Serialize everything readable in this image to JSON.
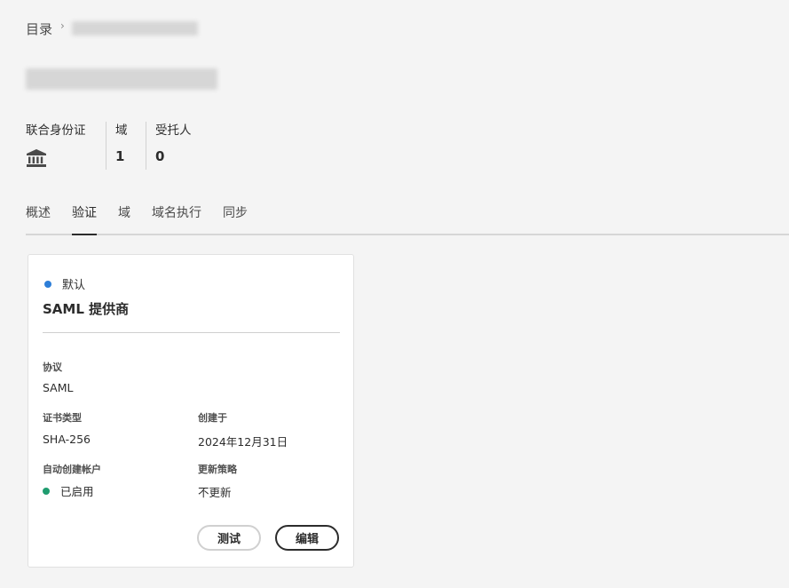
{
  "breadcrumb": {
    "root": "目录",
    "separator": "›"
  },
  "stats": [
    {
      "label": "联合身份证",
      "value_icon": "bank-icon"
    },
    {
      "label": "域",
      "value": "1"
    },
    {
      "label": "受托人",
      "value": "0"
    }
  ],
  "tabs": [
    {
      "label": "概述",
      "active": false
    },
    {
      "label": "验证",
      "active": true
    },
    {
      "label": "域",
      "active": false
    },
    {
      "label": "域名执行",
      "active": false
    },
    {
      "label": "同步",
      "active": false
    }
  ],
  "card": {
    "badge": {
      "label": "默认",
      "color": "#2d7ed8"
    },
    "title": "SAML 提供商",
    "fields": {
      "protocol": {
        "label": "协议",
        "value": "SAML"
      },
      "cert_type": {
        "label": "证书类型",
        "value": "SHA-256"
      },
      "created": {
        "label": "创建于",
        "value": "2024年12月31日"
      },
      "auto_create": {
        "label": "自动创建帐户",
        "value": "已启用",
        "status_color": "#1f9c6f"
      },
      "update_policy": {
        "label": "更新策略",
        "value": "不更新"
      }
    },
    "buttons": {
      "test": "测试",
      "edit": "编辑"
    }
  },
  "colors": {
    "background": "#f4f4f4",
    "card": "#ffffff",
    "text": "#2c2c2c",
    "badge_blue": "#2d7ed8",
    "status_green": "#1f9c6f"
  }
}
